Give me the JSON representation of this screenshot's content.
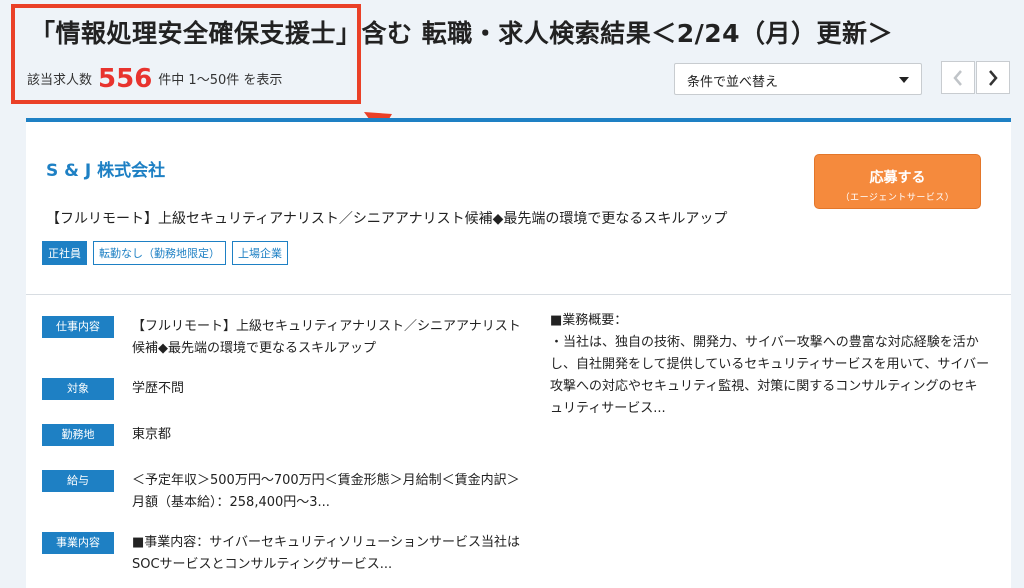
{
  "header": {
    "title": "「情報処理安全確保支援士」含む 転職・求人検索結果＜2/24（月）更新＞",
    "count_prefix": "該当求人数",
    "count": "556",
    "count_suffix": "件中 1〜50件 を表示"
  },
  "sort": {
    "selected": "条件で並べ替え"
  },
  "pager": {
    "prev_icon": "chevron-left-icon",
    "next_icon": "chevron-right-icon"
  },
  "colors": {
    "accent": "#1e80c4",
    "apply": "#f58a3d",
    "highlight": "#ea4027",
    "count": "#e8332e"
  },
  "job": {
    "company": "S & J 株式会社",
    "apply_label": "応募する",
    "apply_sub": "（エージェントサービス）",
    "title": "【フルリモート】上級セキュリティアナリスト／シニアアナリスト候補◆最先端の環境で更なるスキルアップ",
    "tags": [
      "正社員",
      "転勤なし（勤務地限定）",
      "上場企業"
    ],
    "details": [
      {
        "label": "仕事内容",
        "value": "【フルリモート】上級セキュリティアナリスト／シニアアナリスト候補◆最先端の環境で更なるスキルアップ"
      },
      {
        "label": "対象",
        "value": "学歴不問"
      },
      {
        "label": "勤務地",
        "value": "東京都"
      },
      {
        "label": "給与",
        "value": "＜予定年収＞500万円〜700万円＜賃金形態＞月給制＜賃金内訳＞月額（基本給）：258,400円〜3..."
      },
      {
        "label": "事業内容",
        "value": "■事業内容：サイバーセキュリティソリューションサービス当社はSOCサービスとコンサルティングサービス..."
      }
    ],
    "overview": "■業務概要：\n・当社は、独自の技術、開発力、サイバー攻撃への豊富な対応経験を活かし、自社開発をして提供しているセキュリティサービスを用いて、サイバー攻撃への対応やセキュリティ監視、対策に関するコンサルティングのセキュリティサービス..."
  }
}
